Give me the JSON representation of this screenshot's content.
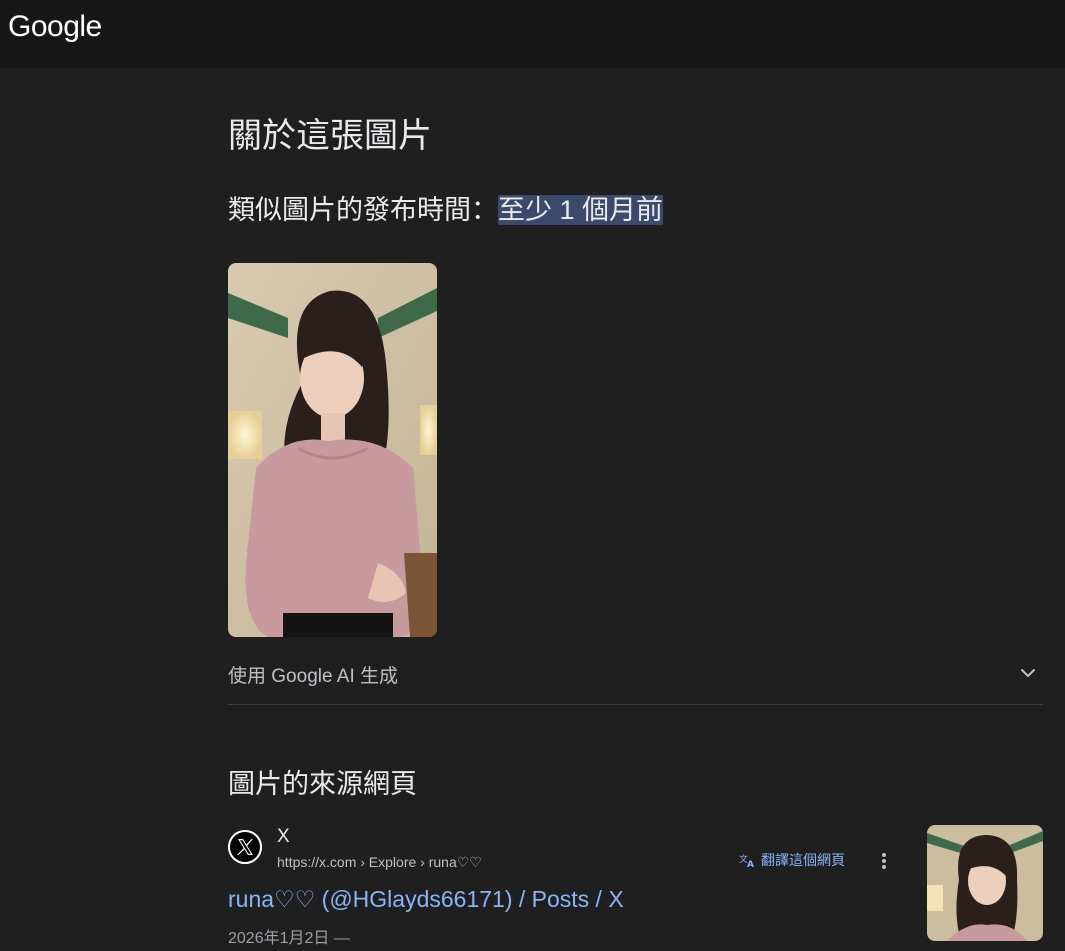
{
  "header": {
    "logo": "Google"
  },
  "about": {
    "title": "關於這張圖片",
    "published_prefix": "類似圖片的發布時間：",
    "published_value": "至少 1 個月前"
  },
  "ai": {
    "label": "使用 Google AI 生成"
  },
  "sources": {
    "title": "圖片的來源網頁",
    "result": {
      "site_name": "X",
      "url": "https://x.com › Explore › runa♡♡",
      "translate_label": "翻譯這個網頁",
      "title": "runa♡♡ (@HGlayds66171) / Posts / X",
      "date": "2026年1月2日 —"
    }
  },
  "colors": {
    "background": "#1f1f1f",
    "topbar": "#171717",
    "link": "#8ab4f8",
    "highlight": "#3b4a6b"
  }
}
